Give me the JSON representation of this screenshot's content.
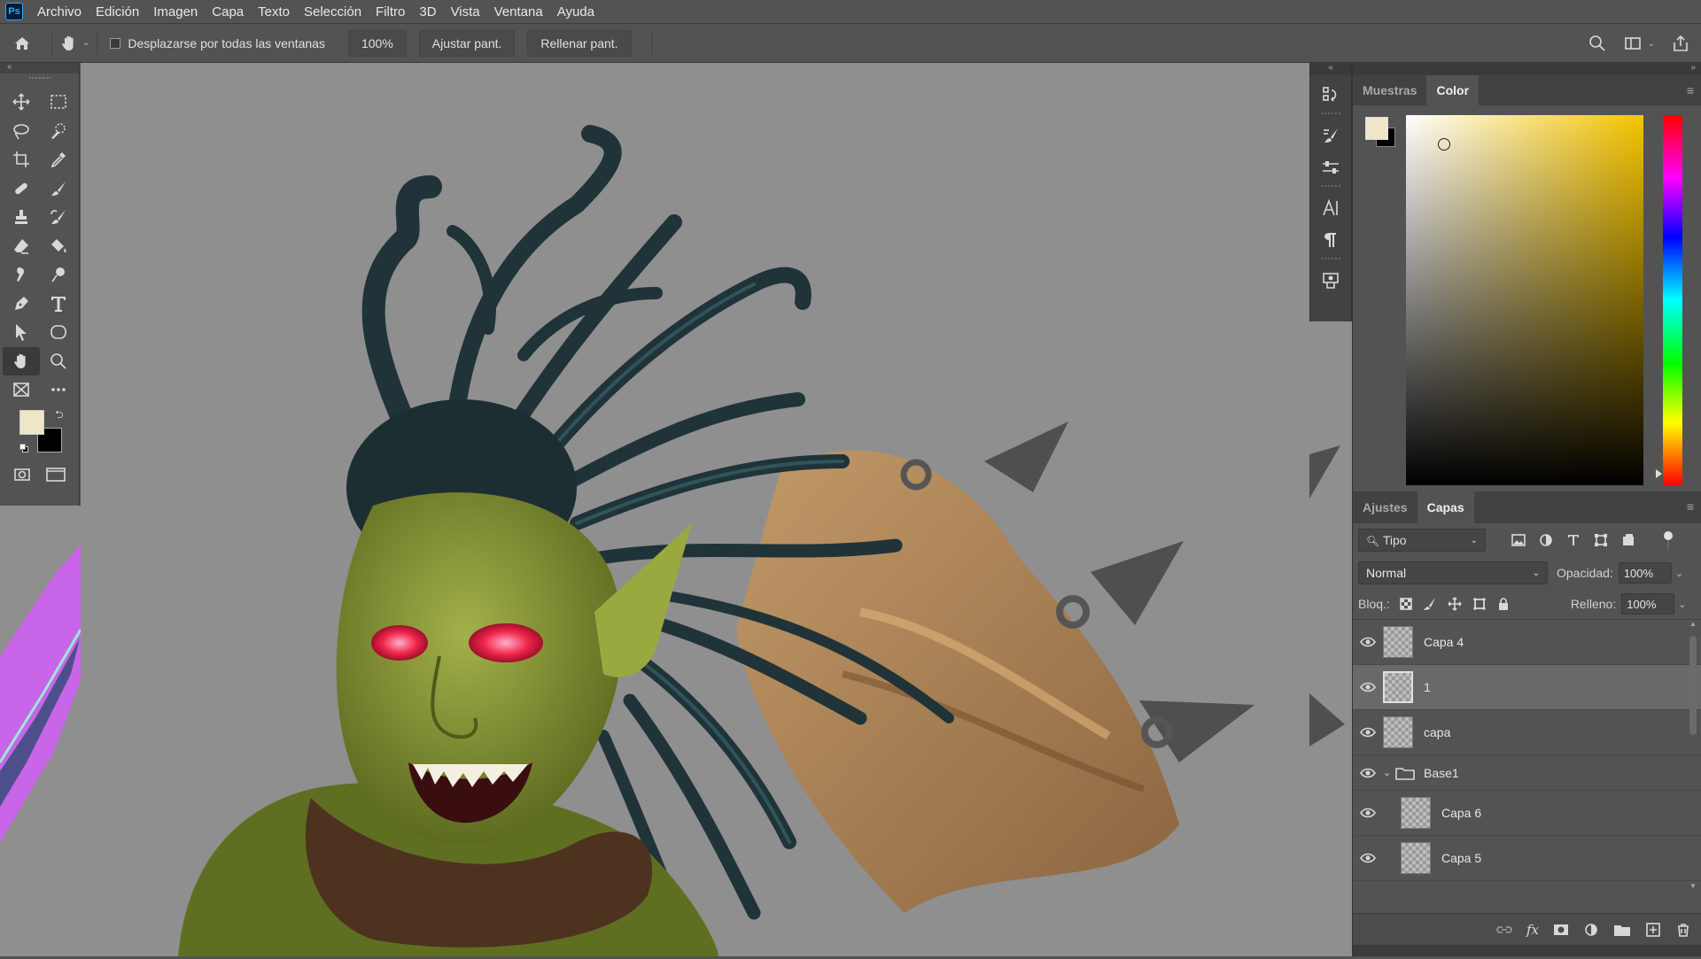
{
  "menubar": {
    "app_logo": "Ps",
    "items": [
      "Archivo",
      "Edición",
      "Imagen",
      "Capa",
      "Texto",
      "Selección",
      "Filtro",
      "3D",
      "Vista",
      "Ventana",
      "Ayuda"
    ]
  },
  "options": {
    "scroll_all_label": "Desplazarse por todas las ventanas",
    "zoom_value": "100%",
    "fit_screen": "Ajustar pant.",
    "fill_screen": "Rellenar pant."
  },
  "tools": {
    "foreground_color": "#efe6c8",
    "background_color": "#000000",
    "items": [
      "move-icon",
      "marquee-icon",
      "lasso-icon",
      "quick-select-icon",
      "crop-icon",
      "eyedropper-icon",
      "healing-icon",
      "brush-icon",
      "stamp-icon",
      "history-brush-icon",
      "eraser-icon",
      "paint-bucket-icon",
      "smudge-icon",
      "dodge-icon",
      "pen-icon",
      "type-icon",
      "path-select-icon",
      "ellipse-icon",
      "hand-icon",
      "zoom-icon",
      "frame-icon",
      "more-icon"
    ],
    "active_tool": "hand-icon"
  },
  "color_panel": {
    "tabs": [
      "Muestras",
      "Color"
    ],
    "active_tab": "Color",
    "hue_color": "#f5c400"
  },
  "layers_panel": {
    "tabs": [
      "Ajustes",
      "Capas"
    ],
    "active_tab": "Capas",
    "filter_kind": "Tipo",
    "blend_mode": "Normal",
    "opacity_label": "Opacidad:",
    "opacity_value": "100%",
    "lock_label": "Bloq.:",
    "fill_label": "Relleno:",
    "fill_value": "100%",
    "layers": [
      {
        "name": "Capa 4",
        "type": "layer",
        "selected": false
      },
      {
        "name": "1",
        "type": "layer",
        "selected": true
      },
      {
        "name": "capa",
        "type": "layer",
        "selected": false
      },
      {
        "name": "Base1",
        "type": "group",
        "selected": false
      },
      {
        "name": "Capa 6",
        "type": "layer",
        "selected": false
      },
      {
        "name": "Capa 5",
        "type": "layer",
        "selected": false
      }
    ]
  }
}
